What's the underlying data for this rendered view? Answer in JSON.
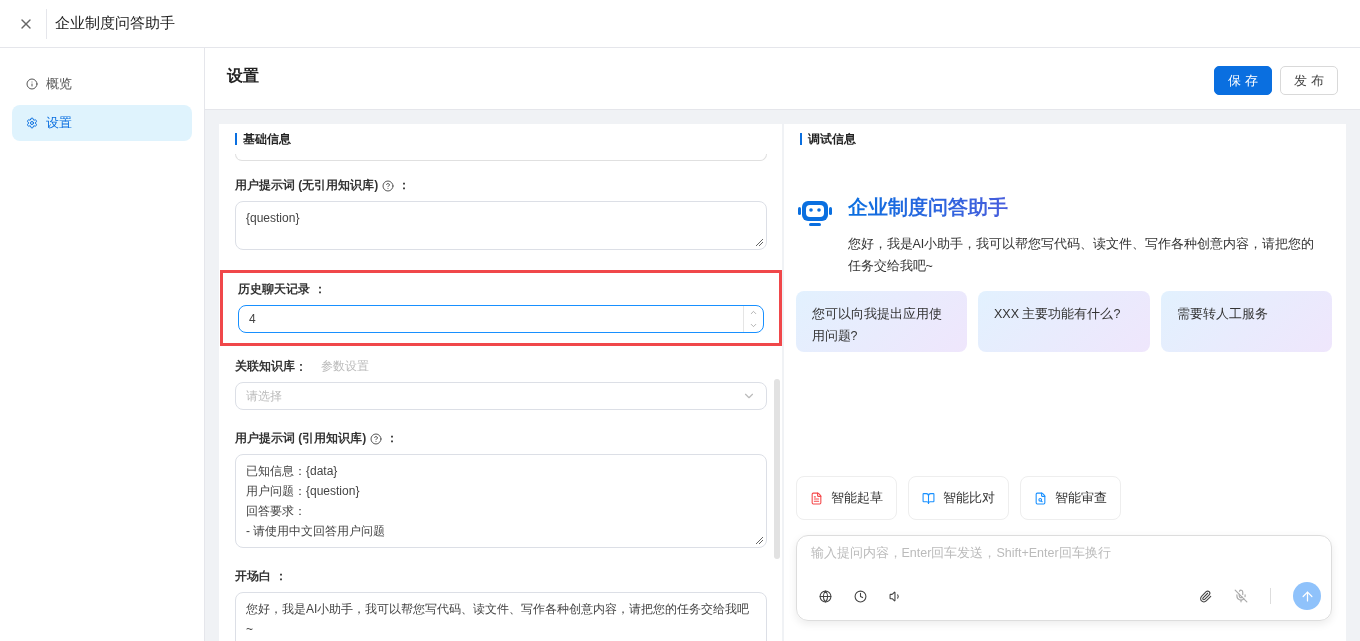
{
  "window": {
    "title": "企业制度问答助手"
  },
  "sidebar": {
    "items": [
      {
        "label": "概览",
        "kind": "overview",
        "selected": false
      },
      {
        "label": "设置",
        "kind": "settings",
        "selected": true
      }
    ]
  },
  "page": {
    "title": "设置",
    "buttons": [
      {
        "label": "保 存",
        "primary": true
      },
      {
        "label": "发 布",
        "primary": false
      }
    ]
  },
  "form": {
    "title": "基础信息",
    "fields": [
      {
        "kind": "clipped"
      },
      {
        "kind": "textarea",
        "label": "用户提示词 (无引用知识库)",
        "help": true,
        "colon": "：",
        "value": "{question}"
      },
      {
        "kind": "number",
        "label": "历史聊天记录",
        "colon": "：",
        "value": "4",
        "focused": true,
        "highlighted": true
      },
      {
        "kind": "select",
        "label": "关联知识库",
        "colon": ":",
        "link": "参数设置",
        "placeholder": "请选择"
      },
      {
        "kind": "textarea",
        "label": "用户提示词 (引用知识库)",
        "help": true,
        "colon": "：",
        "value": "已知信息：{data}\n用户问题：{question}\n回答要求：\n- 请使用中文回答用户问题"
      },
      {
        "kind": "textarea",
        "label": "开场白",
        "colon": "：",
        "value": "您好，我是AI小助手，我可以帮您写代码、读文件、写作各种创意内容，请把您的任务交给我吧~",
        "tall": true
      }
    ]
  },
  "debug": {
    "title": "调试信息",
    "assistant": {
      "name": "企业制度问答助手",
      "greeting": "您好，我是AI小助手，我可以帮您写代码、读文件、写作各种创意内容，请把您的任务交给我吧~"
    },
    "suggestions": [
      "您可以向我提出应用使用问题?",
      "XXX 主要功能有什么?",
      "需要转人工服务"
    ],
    "tools": [
      {
        "label": "智能起草",
        "kind": "draft"
      },
      {
        "label": "智能比对",
        "kind": "compare"
      },
      {
        "label": "智能审查",
        "kind": "review"
      }
    ],
    "composer": {
      "placeholder": "输入提问内容，Enter回车发送，Shift+Enter回车换行",
      "send_disabled": true
    }
  }
}
